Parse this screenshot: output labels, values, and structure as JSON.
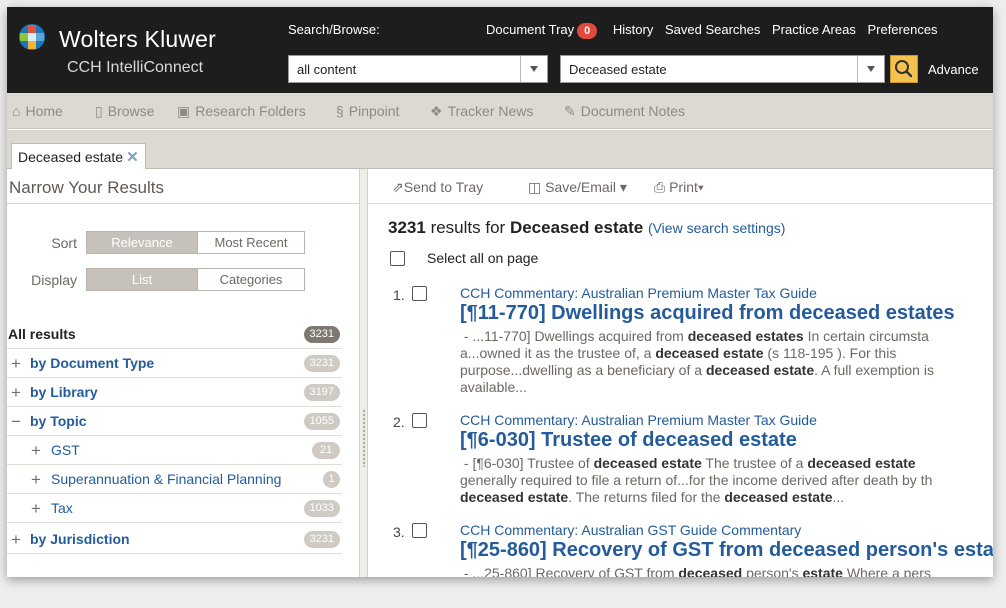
{
  "brand": {
    "name": "Wolters Kluwer",
    "product": "CCH IntelliConnect",
    "logo_colors": [
      "#e2523b",
      "#8cc63f",
      "#5ba4d8",
      "#f5b335",
      "#1b77b9"
    ]
  },
  "search": {
    "label": "Search/Browse:",
    "scope_value": "all content",
    "query_value": "Deceased estate",
    "advanced_label": "Advance"
  },
  "top_links": {
    "document_tray": "Document Tray",
    "tray_count": "0",
    "history": "History",
    "saved_searches": "Saved Searches",
    "practice_areas": "Practice Areas",
    "preferences": "Preferences"
  },
  "nav": {
    "home": "Home",
    "browse": "Browse",
    "research_folders": "Research Folders",
    "pinpoint": "Pinpoint",
    "tracker_news": "Tracker News",
    "document_notes": "Document Notes"
  },
  "tab": {
    "label": "Deceased estate"
  },
  "narrow": {
    "title": "Narrow Your Results",
    "sort_label": "Sort",
    "sort_options": [
      "Relevance",
      "Most Recent"
    ],
    "display_label": "Display",
    "display_options": [
      "List",
      "Categories"
    ],
    "facets": [
      {
        "sign": "",
        "label": "All results",
        "count": "3231"
      },
      {
        "sign": "+",
        "label": "by Document Type",
        "count": "3231"
      },
      {
        "sign": "+",
        "label": "by Library",
        "count": "3197"
      },
      {
        "sign": "−",
        "label": "by Topic",
        "count": "1055"
      },
      {
        "sign": "+",
        "label": "GST",
        "count": "21"
      },
      {
        "sign": "+",
        "label": "Superannuation & Financial Planning",
        "count": "1"
      },
      {
        "sign": "+",
        "label": "Tax",
        "count": "1033"
      },
      {
        "sign": "+",
        "label": "by Jurisdiction",
        "count": "3231"
      }
    ]
  },
  "toolbar": {
    "send_to_tray": "Send to Tray",
    "save_email": "Save/Email",
    "print": "Print"
  },
  "results": {
    "count": "3231",
    "results_for": "results for",
    "query": "Deceased estate",
    "view_settings": "(View search settings)",
    "select_all": "Select all on page",
    "items": [
      {
        "num": "1.",
        "source": "CCH Commentary: Australian Premium Master Tax Guide",
        "title": "[¶11-770] Dwellings acquired from deceased estates"
      },
      {
        "num": "2.",
        "source": "CCH Commentary: Australian Premium Master Tax Guide",
        "title": "[¶6-030] Trustee of deceased estate"
      },
      {
        "num": "3.",
        "source": "CCH Commentary: Australian GST Guide Commentary",
        "title": "[¶25-860] Recovery of GST from deceased person's esta"
      }
    ],
    "snippets": {
      "r1": {
        "l1a": " - ...11-770] Dwellings acquired from ",
        "l1b": "deceased estates",
        "l1c": " In certain circumsta",
        "l2a": "a...owned it as the trustee of, a ",
        "l2b": "deceased estate",
        "l2c": " (s 118-195 ). For this",
        "l3a": "purpose...dwelling as a beneficiary of a ",
        "l3b": "deceased estate",
        "l3c": ". A full exemption is",
        "l4a": "available..."
      },
      "r2": {
        "l1a": " - [¶6-030] Trustee of ",
        "l1b": "deceased estate",
        "l1c": " The trustee of a ",
        "l1d": "deceased estate",
        "l2a": "generally required to file a return of...for the income derived after death by th",
        "l3a": "deceased estate",
        "l3b": ". The returns filed for the ",
        "l3c": "deceased estate",
        "l3d": "..."
      },
      "r3": {
        "l1a": " - ...25-860] Recovery of GST from ",
        "l1b": "deceased",
        "l1c": " person's ",
        "l1d": "estate",
        "l1e": " Where a pers"
      }
    }
  }
}
